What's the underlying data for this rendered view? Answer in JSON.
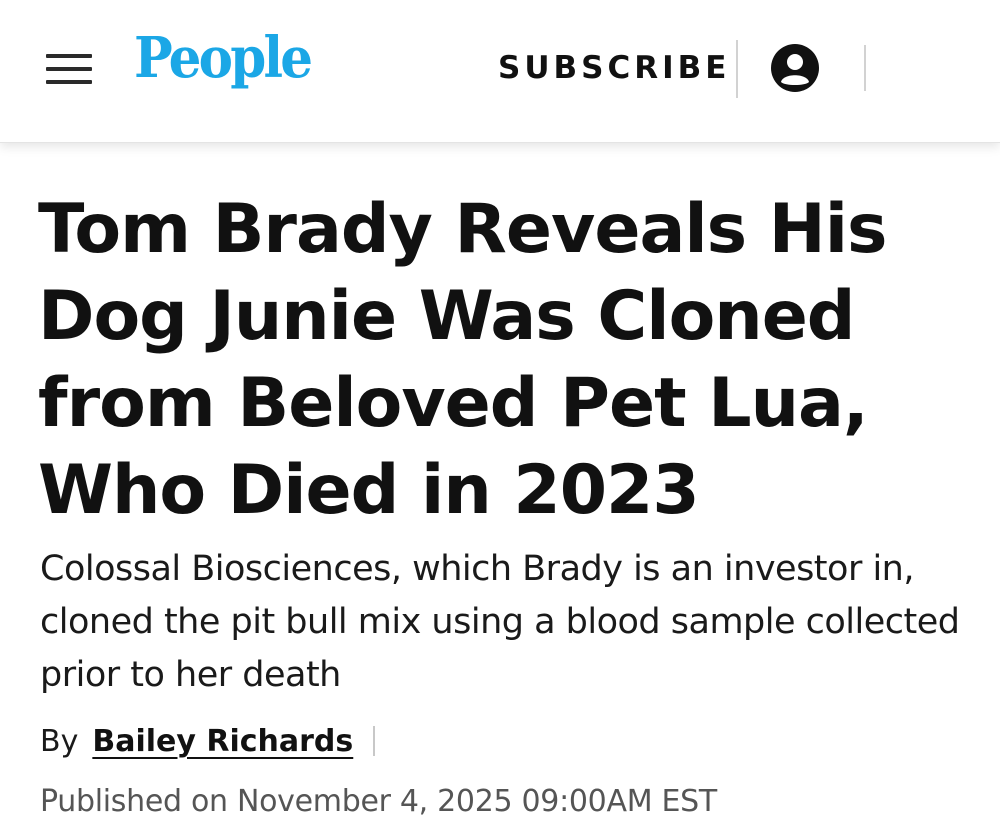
{
  "header": {
    "menu_icon": "hamburger-menu-icon",
    "logo_text": "People",
    "subscribe_label": "SUBSCRIBE",
    "account_icon": "user-account-icon",
    "brand_color": "#1ba7e6"
  },
  "article": {
    "headline": "Tom Brady Reveals His Dog Junie Was Cloned from Beloved Pet Lua, Who Died in 2023",
    "dek": "Colossal Biosciences, which Brady is an investor in, cloned the pit bull mix using a blood sample collected prior to her death",
    "byline_prefix": "By",
    "author": "Bailey Richards",
    "published": "Published on November 4, 2025 09:00AM EST"
  }
}
